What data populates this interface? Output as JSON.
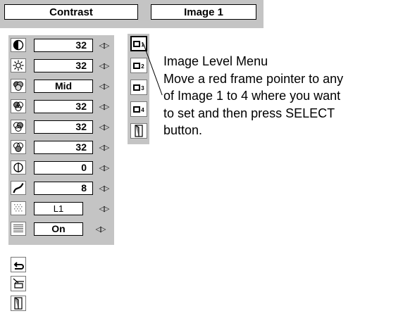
{
  "header": {
    "contrast_label": "Contrast",
    "image_label": "Image 1"
  },
  "menu": {
    "contrast": "32",
    "brightness": "32",
    "color_temp": "Mid",
    "red": "32",
    "green": "32",
    "blue": "32",
    "sharpness": "0",
    "gamma": "8",
    "noise_reduction": "L1",
    "progressive": "On"
  },
  "image_slots": [
    {
      "number": "1"
    },
    {
      "number": "2"
    },
    {
      "number": "3"
    },
    {
      "number": "4"
    }
  ],
  "description": {
    "line1": "Image Level Menu",
    "line2": "Move a red frame pointer to any",
    "line3": "of Image 1 to 4 where you want",
    "line4": "to set  and then press SELECT",
    "line5": "button."
  },
  "icons": {
    "contrast": "half-circle-icon",
    "brightness": "sun-icon",
    "color_temp": "color-temp-icon",
    "red": "red-circles-icon",
    "green": "green-circles-icon",
    "blue": "blue-circles-icon",
    "sharpness": "sharpness-icon",
    "gamma": "gamma-curve-icon",
    "noise": "noise-reduction-icon",
    "progressive": "progressive-icon",
    "reset": "reset-icon",
    "store": "store-icon",
    "exit": "exit-door-icon"
  },
  "colors": {
    "panel_gray": "#c4c4c4",
    "background": "#ffffff"
  }
}
